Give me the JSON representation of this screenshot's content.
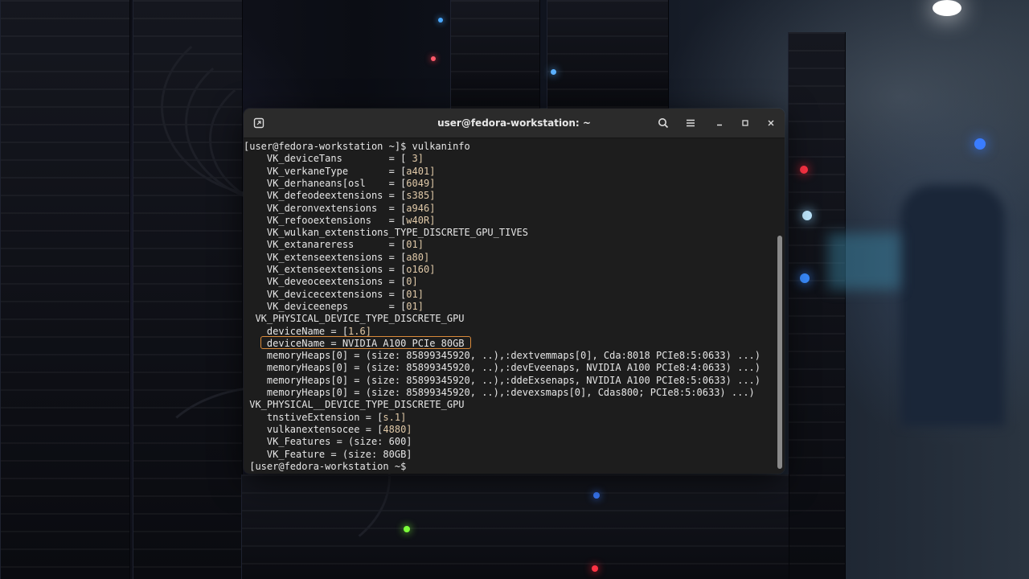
{
  "window": {
    "title": "user@fedora-workstation: ~"
  },
  "icons": {
    "new_tab": "new-tab-icon",
    "search": "search-icon",
    "menu": "hamburger-menu-icon",
    "minimize": "minimize-icon",
    "maximize": "maximize-icon",
    "close": "close-icon"
  },
  "terminal": {
    "lines": [
      {
        "prefix": "[user@fedora-workstation ~]$ vulkaninfo",
        "value": ""
      },
      {
        "prefix": "    VK_deviceTans        = [",
        "value": " 3]"
      },
      {
        "prefix": "    VK_verkaneType       = [",
        "value": "a401]"
      },
      {
        "prefix": "    VK_derhaneans[osl    = [",
        "value": "6049]"
      },
      {
        "prefix": "    VK_defeodeextensions = [",
        "value": "s385]"
      },
      {
        "prefix": "    VK_deronvextensions  = [",
        "value": "a946]"
      },
      {
        "prefix": "    VK_refooextensions   = [",
        "value": "w40R]"
      },
      {
        "prefix": "    VK_wulkan_extenstions_TYPE_DISCRETE_GPU_TIVES",
        "value": ""
      },
      {
        "prefix": "    VK_extanareress      = [",
        "value": "01]"
      },
      {
        "prefix": "    VK_extenseextensions = [",
        "value": "a80]"
      },
      {
        "prefix": "    VK_extenseextensions = [",
        "value": "o160]"
      },
      {
        "prefix": "    VK_deveoceextensions = [",
        "value": "0]"
      },
      {
        "prefix": "    VK_devicecextensions = [",
        "value": "01]"
      },
      {
        "prefix": "    VK_deviceeneps       = [",
        "value": "01]"
      },
      {
        "prefix": "  VK_PHYSICAL_DEVICE_TYPE_DISCRETE_GPU",
        "value": ""
      },
      {
        "prefix": "    deviceName = [",
        "value": "1.6]"
      },
      {
        "prefix": "    deviceName = NVIDIA A100 PCIe 80GB",
        "value": ""
      },
      {
        "prefix": "    memoryHeaps[0] = (size: 85899345920, ..),:dextvemmaps[0], Cda:8018 PCIe8:5:0633) ...)",
        "value": ""
      },
      {
        "prefix": "    memoryHeaps[0] = (size: 85899345920, ..),:devEveenaps, NVIDIA A100 PCIe8:4:0633) ...)",
        "value": ""
      },
      {
        "prefix": "    memoryHeaps[0] = (size: 85899345920, ..),:ddeExsenaps, NVIDIA A100 PCIe8:5:0633) ...)",
        "value": ""
      },
      {
        "prefix": "    memoryHeaps[0] = (size: 85899345920, ..),:devexsmaps[0], Cdas800; PCIe8:5:0633) ...)",
        "value": ""
      },
      {
        "prefix": " VK_PHYSICAL__DEVICE_TYPE_DISCRETE_GPU",
        "value": ""
      },
      {
        "prefix": "    tnstiveExtension = [",
        "value": "s.1]"
      },
      {
        "prefix": "    vulkanextensocee = [",
        "value": "4880]"
      },
      {
        "prefix": "    VK_Features = (size: 600]",
        "value": ""
      },
      {
        "prefix": "    VK_Feature = (size: 80GB]",
        "value": ""
      },
      {
        "prefix": " [user@fedora-workstation ~$",
        "value": ""
      }
    ]
  },
  "colors": {
    "highlight_border": "#d98a3a",
    "terminal_bg": "#1d1d1d",
    "titlebar_bg": "#2b2b2b"
  }
}
